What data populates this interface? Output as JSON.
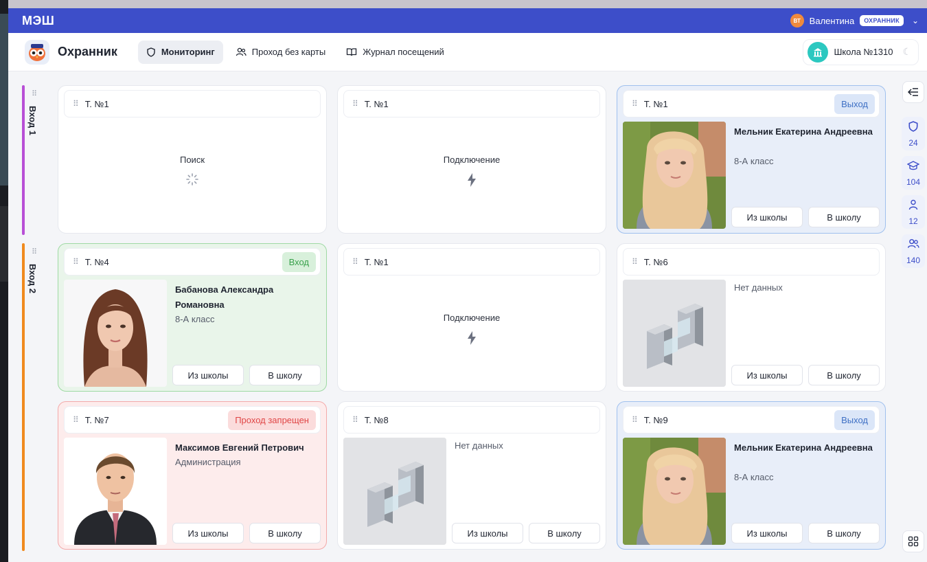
{
  "topbar": {
    "brand": "МЭШ",
    "user_initials": "ВТ",
    "user_name": "Валентина",
    "role": "ОХРАННИК"
  },
  "appbar": {
    "title": "Охранник",
    "tabs": [
      {
        "label": "Мониторинг",
        "icon": "shield-icon",
        "active": true
      },
      {
        "label": "Проход без карты",
        "icon": "users-icon",
        "active": false
      },
      {
        "label": "Журнал посещений",
        "icon": "book-icon",
        "active": false
      }
    ],
    "school": "Школа №1310"
  },
  "groups": [
    {
      "label": "Вход 1",
      "color": "#b84fd6"
    },
    {
      "label": "Вход 2",
      "color": "#f08a1e"
    }
  ],
  "rail": {
    "stats": [
      {
        "icon": "shield-icon",
        "value": "24"
      },
      {
        "icon": "graduation-cap-icon",
        "value": "104"
      },
      {
        "icon": "person-icon",
        "value": "12"
      },
      {
        "icon": "people-icon",
        "value": "140"
      }
    ]
  },
  "cards": [
    {
      "terminal": "Т. №1",
      "state": "Поиск"
    },
    {
      "terminal": "Т. №1",
      "state": "Подключение"
    },
    {
      "terminal": "Т. №1",
      "status": "Выход",
      "name": "Мельник Екатерина Андреевна",
      "class": "8-А класс",
      "btn_out": "Из школы",
      "btn_in": "В школу"
    },
    {
      "terminal": "Т. №4",
      "status": "Вход",
      "name": "Бабанова Александра Романовна",
      "class": "8-А класс",
      "btn_out": "Из школы",
      "btn_in": "В школу"
    },
    {
      "terminal": "Т. №1",
      "state": "Подключение"
    },
    {
      "terminal": "Т. №6",
      "nodata": "Нет данных",
      "btn_out": "Из школы",
      "btn_in": "В школу"
    },
    {
      "terminal": "Т. №7",
      "status": "Проход запрещен",
      "name": "Максимов Евгений Петрович",
      "class": "Администрация",
      "btn_out": "Из школы",
      "btn_in": "В школу"
    },
    {
      "terminal": "Т. №8",
      "nodata": "Нет данных",
      "btn_out": "Из школы",
      "btn_in": "В школу"
    },
    {
      "terminal": "Т. №9",
      "status": "Выход",
      "name": "Мельник Екатерина Андреевна",
      "class": "8-А класс",
      "btn_out": "Из школы",
      "btn_in": "В школу"
    }
  ]
}
